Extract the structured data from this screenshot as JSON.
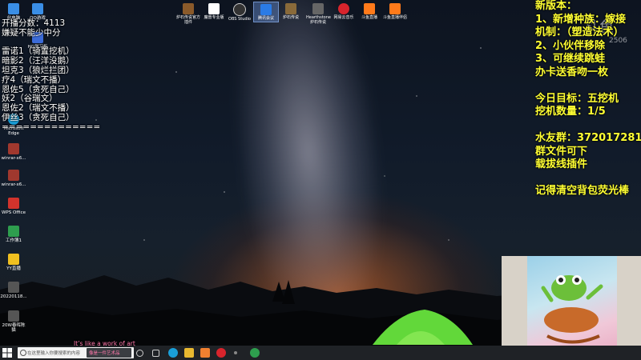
{
  "overlay_left": [
    "开播分数：4113",
    "嫌疑不能少中分",
    "",
    "雷诺1（骑置挖机）",
    "暗影2（汪洋没鹅）",
    "坦克3（狼烂拦团）",
    "疗4（瑞文不播）",
    "恩佐5（贪死自己）",
    "妖2（谷瑞文）",
    "恩佐2（瑞文不播）",
    "伊丝3（贪死自己）",
    "=============="
  ],
  "overlay_right": [
    "新版本：",
    "1、新增种族：嫁接",
    "机制：（塑造法术）",
    "2、小伙伴移除",
    "3、可继续跳蛙",
    "办卡送香吻一枚",
    "",
    "今日目标：五挖机",
    "挖机数量：1/5",
    "",
    "水友群：372017281",
    "群文件可下",
    "载拔线插件",
    "",
    "记得清空背包荧光棒"
  ],
  "desktop_icons_left": [
    {
      "label": "此电脑",
      "color": "#3a8ee6"
    },
    {
      "label": "Microsoft Edge",
      "color": "#1a9fd8"
    },
    {
      "label": "winrar-x6...",
      "color": "#a0382e"
    },
    {
      "label": "winrar-x6...",
      "color": "#a0382e"
    },
    {
      "label": "WPS Office",
      "color": "#d2332c"
    },
    {
      "label": "工作簿1",
      "color": "#2e9e4e"
    },
    {
      "label": "YY直播",
      "color": "#f0c020"
    },
    {
      "label": "20220118...",
      "color": "#555555"
    },
    {
      "label": "20W春晖陈 猫",
      "color": "#555555"
    }
  ],
  "desktop_icons_col2": [
    {
      "label": "QQ游戏",
      "color": "#3a8ee6"
    },
    {
      "label": "HG学习板",
      "color": "#3c6bd8"
    }
  ],
  "desktop_icons_top": [
    {
      "label": "炉石传说官方插件",
      "color": "#8a5a2a",
      "selected": false
    },
    {
      "label": "魔兽专业版",
      "color": "#ffffff",
      "selected": false
    },
    {
      "label": "OBS Studio",
      "color": "#333333",
      "selected": false
    },
    {
      "label": "腾讯会议",
      "color": "#2a7be6",
      "selected": true
    },
    {
      "label": "炉石传说",
      "color": "#8a6a3a",
      "selected": false
    },
    {
      "label": "Hearthstone 炉石传说",
      "color": "#666666",
      "selected": false
    },
    {
      "label": "网易云音乐",
      "color": "#d8242c",
      "selected": false
    },
    {
      "label": "斗鱼直播",
      "color": "#ff7a1a",
      "selected": false
    },
    {
      "label": "斗鱼直播伴侣",
      "color": "#ff7a1a",
      "selected": false
    }
  ],
  "watermark": {
    "text": "斗鱼",
    "number": "2506"
  },
  "caption": "It’s like a work of art",
  "taskbar": {
    "search_placeholder": "在这里输入你要搜索的内容",
    "running_title": "像是一件艺术品"
  },
  "colors": {
    "overlay_right": "#ffff33",
    "caption": "#ff77aa",
    "taskbar": "#1f2226"
  }
}
